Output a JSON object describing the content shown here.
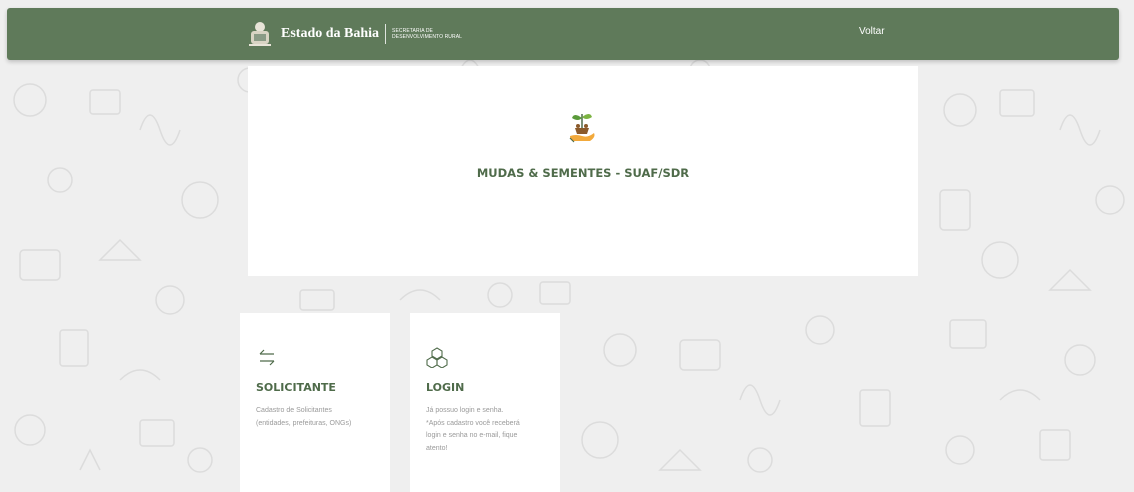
{
  "colors": {
    "navbar": "#5f7a5a",
    "accent_green": "#4f6b4a",
    "background": "#efefef",
    "card": "#ffffff",
    "muted_text": "#9a9a9a"
  },
  "header": {
    "brand_name": "Estado da Bahia",
    "brand_sub_line1": "SECRETARIA DE",
    "brand_sub_line2": "DESENVOLVIMENTO RURAL",
    "crest_icon": "bahia-crest-icon",
    "back_label": "Voltar"
  },
  "hero": {
    "icon": "plant-in-hand-icon",
    "title": "MUDAS & SEMENTES - SUAF/SDR"
  },
  "cards": [
    {
      "icon": "arrows-exchange-icon",
      "title": "SOLICITANTE",
      "desc_line1": "Cadastro de Solicitantes",
      "desc_line2": "(entidades, prefeituras, ONGs)"
    },
    {
      "icon": "cubes-icon",
      "title": "LOGIN",
      "desc_line1": "Já possuo login e senha.",
      "desc_line2": "*Após cadastro você receberá",
      "desc_line3": "login e senha no e-mail, fique",
      "desc_line4": "atento!"
    }
  ]
}
